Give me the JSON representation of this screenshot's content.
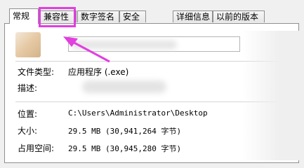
{
  "tabs": [
    {
      "label": "常规",
      "active": true
    },
    {
      "label": "兼容性",
      "active": false
    },
    {
      "label": "数字签名",
      "active": false
    },
    {
      "label": "安全",
      "active": false
    },
    {
      "label": "详细信息",
      "active": false
    },
    {
      "label": "以前的版本",
      "active": false
    }
  ],
  "annotation_color": "#e23ee0",
  "file": {
    "type_label": "文件类型:",
    "type_value": "应用程序 (.exe)",
    "description_label": "描述:",
    "location_label": "位置:",
    "location_value": "C:\\Users\\Administrator\\Desktop",
    "size_label": "大小:",
    "size_value": "29.5 MB (30,941,264 字节)",
    "disk_size_label": "占用空间:",
    "disk_size_value": "29.5 MB (30,945,280 字节)"
  }
}
